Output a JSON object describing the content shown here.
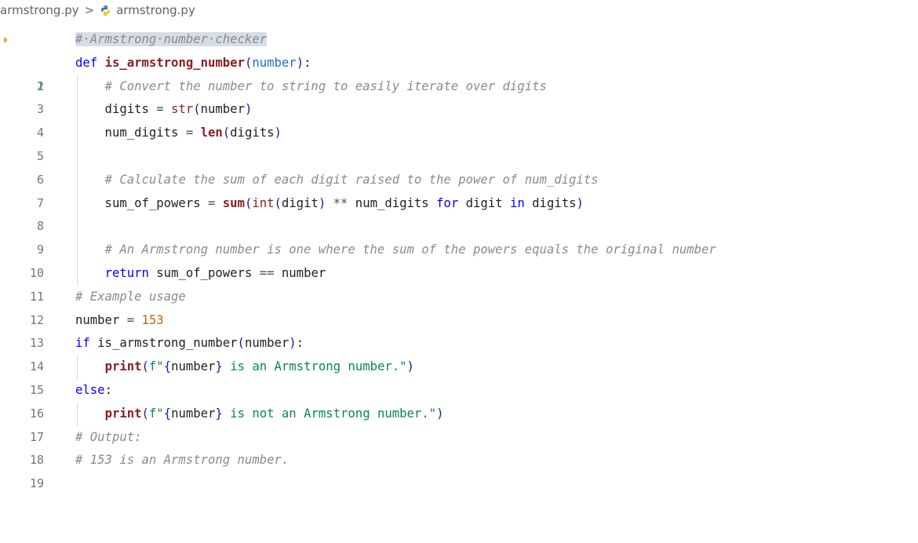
{
  "breadcrumb": {
    "folder": "armstrong.py",
    "separator": ">",
    "file": "armstrong.py",
    "file_icon": "python-file-icon"
  },
  "editor": {
    "active_line": 1,
    "lines": [
      {
        "n": "1",
        "text": "# Armstrong number checker"
      },
      {
        "n": "2",
        "text": "def is_armstrong_number(number):"
      },
      {
        "n": "3",
        "text": "    # Convert the number to string to easily iterate over digits"
      },
      {
        "n": "4",
        "text": "    digits = str(number)"
      },
      {
        "n": "5",
        "text": "    num_digits = len(digits)"
      },
      {
        "n": "6",
        "text": ""
      },
      {
        "n": "7",
        "text": "    # Calculate the sum of each digit raised to the power of num_digits"
      },
      {
        "n": "8",
        "text": "    sum_of_powers = sum(int(digit) ** num_digits for digit in digits)"
      },
      {
        "n": "9",
        "text": ""
      },
      {
        "n": "10",
        "text": "    # An Armstrong number is one where the sum of the powers equals the original number"
      },
      {
        "n": "11",
        "text": "    return sum_of_powers == number"
      },
      {
        "n": "12",
        "text": "# Example usage"
      },
      {
        "n": "13",
        "text": "number = 153"
      },
      {
        "n": "14",
        "text": "if is_armstrong_number(number):"
      },
      {
        "n": "15",
        "text": "    print(f\"{number} is an Armstrong number.\")"
      },
      {
        "n": "16",
        "text": "else:"
      },
      {
        "n": "17",
        "text": "    print(f\"{number} is not an Armstrong number.\")"
      },
      {
        "n": "18",
        "text": "# Output:"
      },
      {
        "n": "19",
        "text": "# 153 is an Armstrong number."
      }
    ]
  },
  "colors": {
    "keyword": "#0000ff",
    "function": "#8b1d22",
    "string": "#098658",
    "number": "#b5651d",
    "comment": "#8a8a8a",
    "line_number": "#6e7681",
    "selection": "#d5dde8",
    "breakpoint_marker": "#e2a533"
  }
}
